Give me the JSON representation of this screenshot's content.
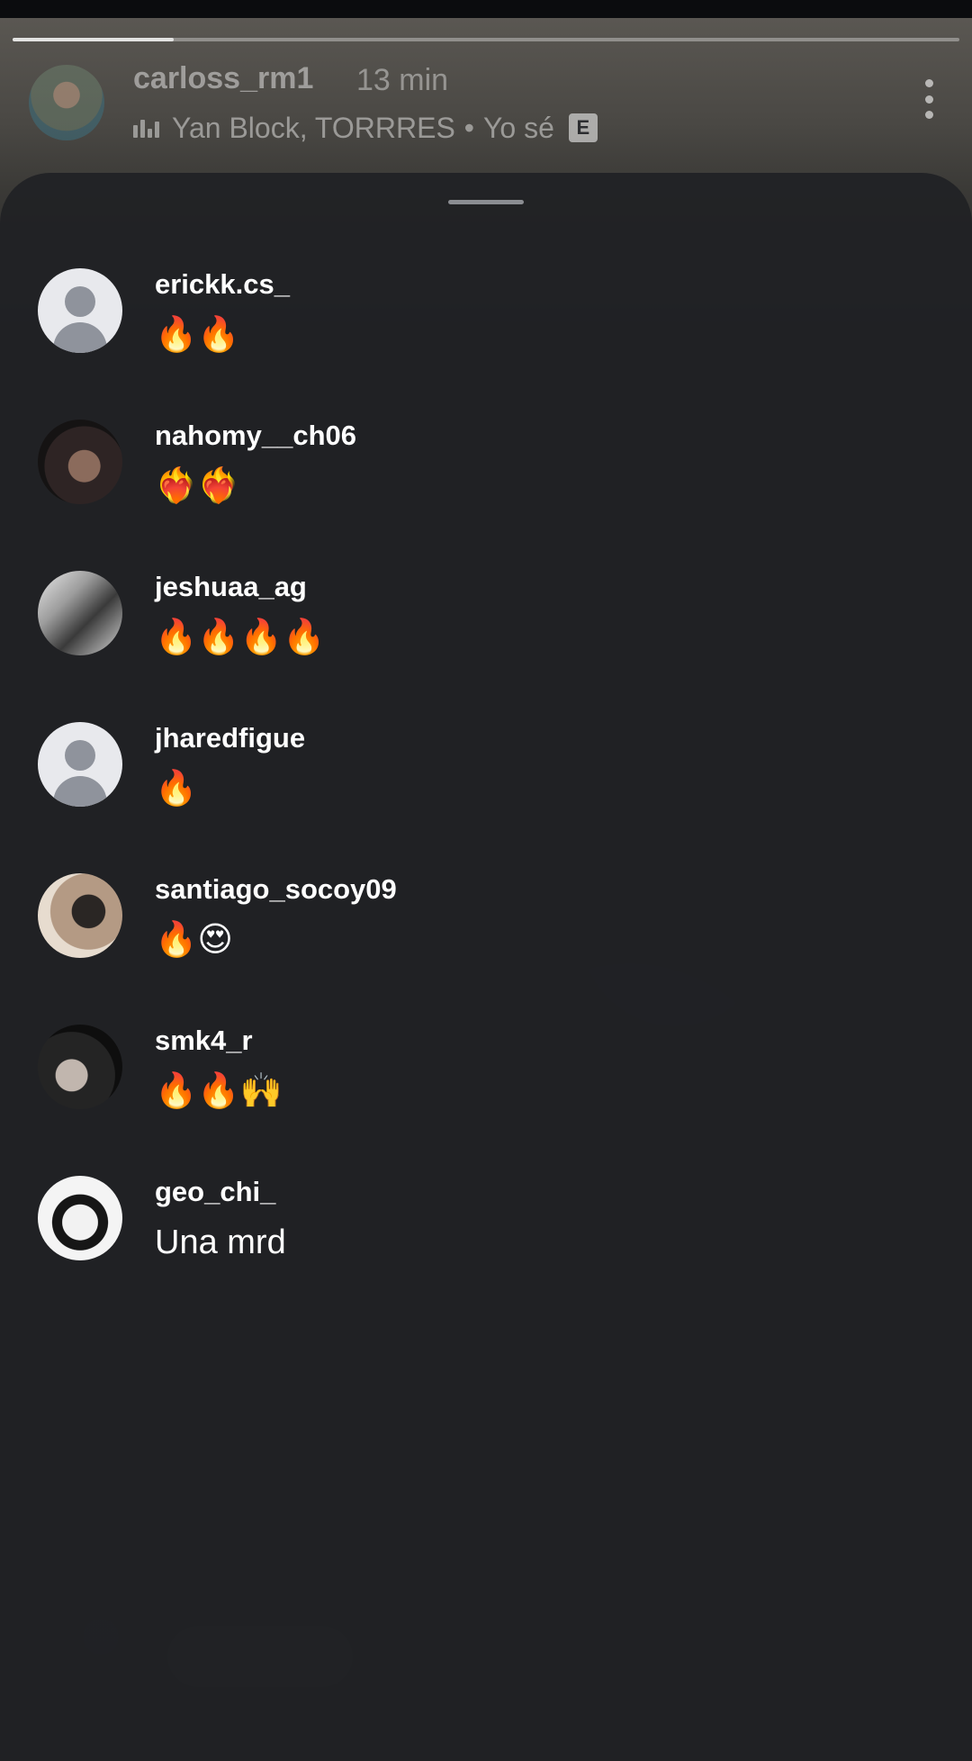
{
  "story": {
    "progress_fraction": 0.17,
    "username": "carloss_rm1",
    "time": "13 min",
    "music_artists": "Yan Block, TORRRES",
    "music_separator": "•",
    "music_title": "Yo sé",
    "explicit_label": "E"
  },
  "replies": [
    {
      "username": "erickk.cs_",
      "message": "🔥🔥",
      "avatar": "default-avatar-icon"
    },
    {
      "username": "nahomy__ch06",
      "message": "❤️‍🔥❤️‍🔥",
      "avatar": "photo"
    },
    {
      "username": "jeshuaa_ag",
      "message": "🔥🔥🔥🔥",
      "avatar": "photo"
    },
    {
      "username": "jharedfigue",
      "message": "🔥",
      "avatar": "default-avatar-icon"
    },
    {
      "username": "santiago_socoy09",
      "message": "🔥😍",
      "avatar": "photo"
    },
    {
      "username": "smk4_r",
      "message": "🔥🔥🙌",
      "avatar": "photo"
    },
    {
      "username": "geo_chi_",
      "message": "Una mrd",
      "avatar": "photo"
    }
  ]
}
